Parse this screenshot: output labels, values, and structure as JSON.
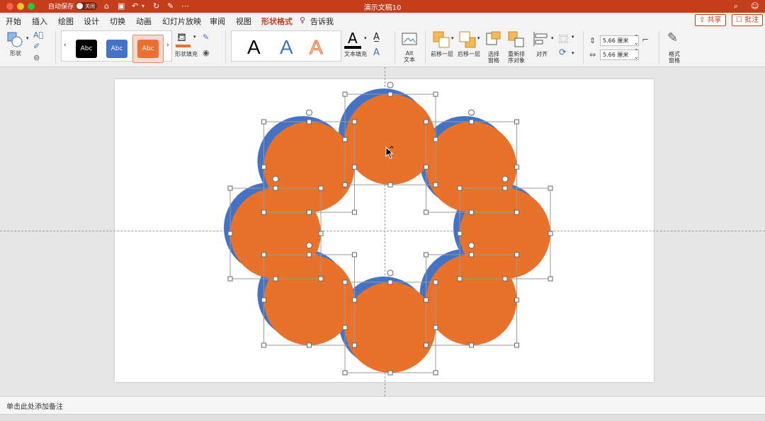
{
  "titlebar": {
    "autosave_label": "自动保存",
    "autosave_state": "关闭",
    "doc_title": "演示文稿10",
    "accent_color": "#c43e1c"
  },
  "menu": {
    "tabs": [
      "开始",
      "插入",
      "绘图",
      "设计",
      "切换",
      "动画",
      "幻灯片放映",
      "审阅",
      "视图",
      "形状格式",
      "告诉我"
    ],
    "active_tab": "形状格式",
    "share_label": "共享",
    "comment_label": "批注"
  },
  "ribbon": {
    "shape_label": "形状",
    "style_swatches": [
      {
        "label": "Abc",
        "color": "#000000"
      },
      {
        "label": "Abc",
        "color": "#4472c4"
      },
      {
        "label": "Abc",
        "color": "#e97030"
      }
    ],
    "shape_fill_label": "形状填充",
    "text_fill_label": "文本填充",
    "alt_text_label": "Alt\n文本",
    "alt_label_1": "Alt",
    "alt_label_2": "文本",
    "bring_forward_label": "前移一层",
    "send_backward_label": "后移一层",
    "selection_pane_label_1": "选择",
    "selection_pane_label_2": "窗格",
    "reorder_label_1": "重新排",
    "reorder_label_2": "序对象",
    "align_label": "对齐",
    "height_value": "5.66 厘米",
    "width_value": "5.66 厘米",
    "format_pane_label_1": "格式",
    "format_pane_label_2": "窗格"
  },
  "slide": {
    "shape_colors": {
      "front": "#e8722a",
      "back": "#4472c4"
    }
  },
  "notes": {
    "placeholder": "单击此处添加备注"
  }
}
